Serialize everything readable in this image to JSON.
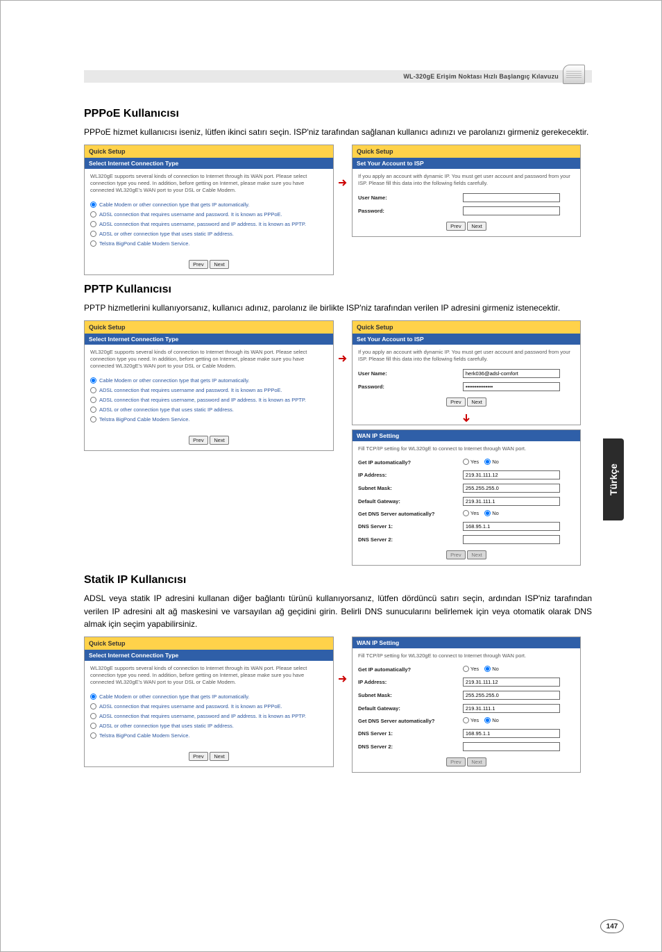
{
  "guide_title": "WL-320gE Erişim Noktası Hızlı Başlangıç Kılavuzu",
  "sidetab": "Türkçe",
  "page_number": "147",
  "s1": {
    "title": "PPPoE Kullanıcısı",
    "lead": "PPPoE hizmet kullanıcısı iseniz, lütfen ikinci satırı seçin. ISP'niz tarafından sağlanan kullanıcı adınızı ve parolanızı girmeniz gerekecektir."
  },
  "s2": {
    "title": "PPTP Kullanıcısı",
    "lead": "PPTP hizmetlerini kullanıyorsanız, kullanıcı adınız, parolanız ile birlikte ISP'niz tarafından verilen IP adresini girmeniz istenecektir."
  },
  "s3": {
    "title": "Statik IP Kullanıcısı",
    "lead": "ADSL veya statik IP adresini kullanan diğer bağlantı türünü kullanıyorsanız, lütfen dördüncü satırı seçin, ardından ISP'niz tarafından verilen IP adresini alt ağ maskesini ve varsayılan ağ geçidini girin. Belirli DNS sunucularını belirlemek için veya otomatik olarak DNS almak için seçim yapabilirsiniz."
  },
  "panels": {
    "quick_setup": "Quick Setup",
    "select_type": "Select Internet Connection Type",
    "blurb": "WL320gE supports several kinds of connection to Internet through its WAN port. Please select connection type you need. In addition, before getting on Internet, please make sure you have connected WL320gE's WAN port to your DSL or Cable Modem.",
    "r1": "Cable Modem or other connection type that gets IP automatically.",
    "r2": "ADSL connection that requires username and password. It is known as PPPoE.",
    "r3": "ADSL connection that requires username, password and IP address. It is known as PPTP.",
    "r4": "ADSL or other connection type that uses static IP address.",
    "r5": "Telstra BigPond Cable Modem Service.",
    "prev": "Prev",
    "next": "Next"
  },
  "isp": {
    "hdr": "Set Your Account to ISP",
    "blurb": "If you apply an account with dynamic IP. You must get user account and password from your ISP. Please fill this data into the following fields carefully.",
    "user_lbl": "User Name:",
    "pass_lbl": "Password:",
    "user_val": "herk036@adsl-comfort",
    "pass_val": "•••••••••••••••"
  },
  "wan": {
    "hdr": "WAN IP Setting",
    "blurb": "Fill TCP/IP setting for WL320gE to connect to Internet through WAN port.",
    "getip_lbl": "Get IP automatically?",
    "ip_lbl": "IP Address:",
    "mask_lbl": "Subnet Mask:",
    "gw_lbl": "Default Gateway:",
    "getdns_lbl": "Get DNS Server automatically?",
    "dns1_lbl": "DNS Server 1:",
    "dns2_lbl": "DNS Server 2:",
    "yes": "Yes",
    "no": "No",
    "ip_val": "219.31.111.12",
    "mask_val": "255.255.255.0",
    "gw_val": "219.31.111.1",
    "dns1_val": "168.95.1.1",
    "dns2_val": ""
  }
}
